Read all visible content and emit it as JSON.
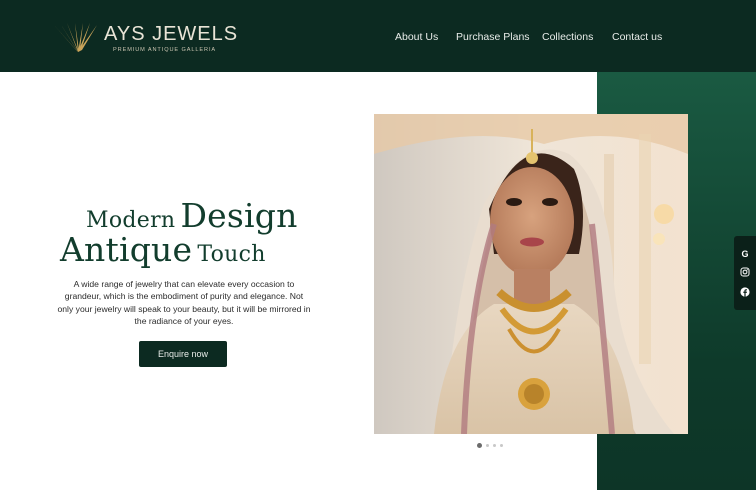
{
  "brand": {
    "name": "AYS JEWELS",
    "tagline": "PREMIUM ANTIQUE GALLERIA",
    "logo_icon": "sunburst-logo-icon",
    "accent_gold": "#c9a45a",
    "header_bg": "#0c2a21"
  },
  "nav": {
    "items": [
      {
        "label": "About Us"
      },
      {
        "label": "Purchase Plans"
      },
      {
        "label": "Collections"
      },
      {
        "label": "Contact us"
      }
    ]
  },
  "hero": {
    "title_line1_a": "Modern",
    "title_line1_b": "Design",
    "title_line2_a": "Antique",
    "title_line2_b": "Touch",
    "description": "A wide range of jewelry that can elevate every occasion to grandeur, which is the embodiment of purity and elegance. Not only your jewelry will speak to your beauty, but it will be mirrored in the radiance of your eyes.",
    "cta_label": "Enquire now"
  },
  "slider": {
    "image_subject": "woman in bridal attire with gold necklace",
    "slides_count": 4,
    "active_slide": 1
  },
  "social": {
    "items": [
      {
        "icon": "google-icon",
        "glyph": "G"
      },
      {
        "icon": "instagram-icon",
        "glyph": ""
      },
      {
        "icon": "facebook-icon",
        "glyph": "f"
      }
    ]
  },
  "colors": {
    "panel_green": "#1a5a42",
    "text_green": "#123d2d"
  }
}
